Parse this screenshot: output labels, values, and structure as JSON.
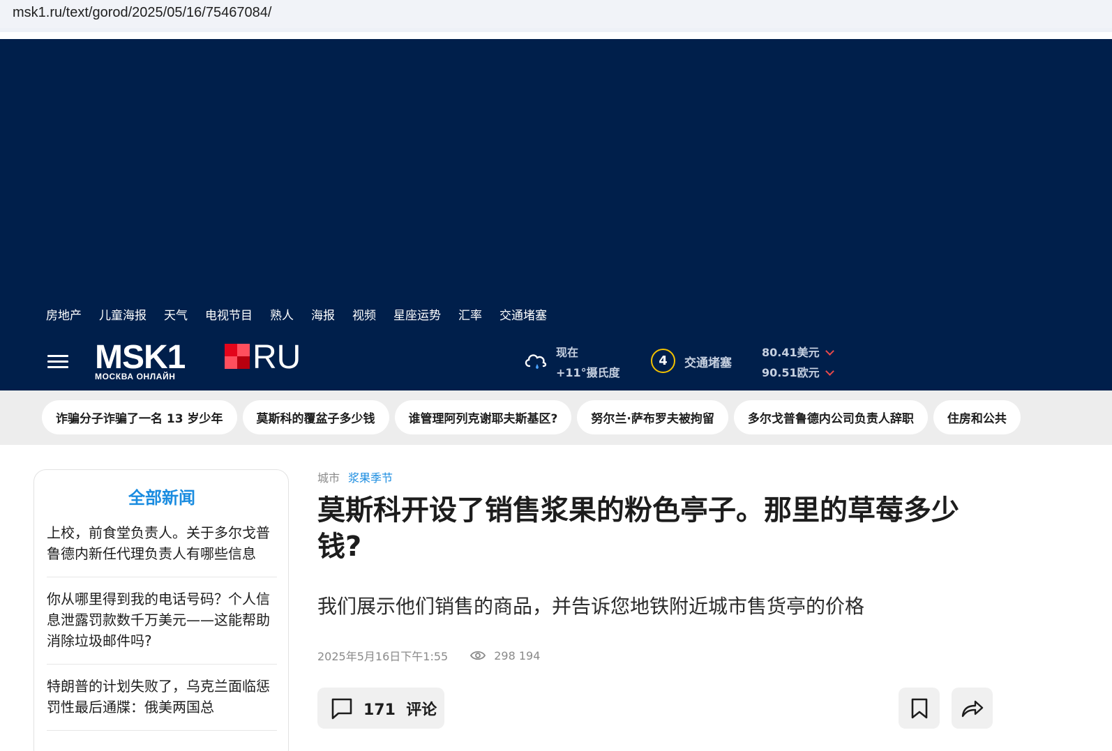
{
  "browser": {
    "url": "msk1.ru/text/gorod/2025/05/16/75467084/"
  },
  "header": {
    "nav": [
      "房地产",
      "儿童海报",
      "天气",
      "电视节目",
      "熟人",
      "海报",
      "视频",
      "星座运势",
      "汇率",
      "交通堵塞"
    ],
    "logo": {
      "main": "MSK1",
      "tld": "RU",
      "subtitle": "МОСКВА ОНЛАЙН"
    },
    "weather": {
      "now_label": "现在",
      "temperature": "+11°摄氏度"
    },
    "traffic": {
      "level": "4",
      "label": "交通堵塞"
    },
    "rates": {
      "usd": "80.41美元",
      "eur": "90.51欧元"
    }
  },
  "trending": [
    "诈骗分子诈骗了一名 13 岁少年",
    "莫斯科的覆盆子多少钱",
    "谁管理阿列克谢耶夫斯基区?",
    "努尔兰·萨布罗夫被拘留",
    "多尔戈普鲁德内公司负责人辞职",
    "住房和公共"
  ],
  "sidebar": {
    "title": "全部新闻",
    "items": [
      "上校，前食堂负责人。关于多尔戈普鲁德内新任代理负责人有哪些信息",
      "你从哪里得到我的电话号码？个人信息泄露罚款数千万美元——这能帮助消除垃圾邮件吗?",
      "特朗普的计划失败了，乌克兰面临惩罚性最后通牒：俄美两国总"
    ]
  },
  "article": {
    "breadcrumb": [
      "城市",
      "浆果季节"
    ],
    "headline": "莫斯科开设了销售浆果的粉色亭子。那里的草莓多少钱?",
    "lead": "我们展示他们销售的商品，并告诉您地铁附近城市售货亭的价格",
    "date": "2025年5月16日下午1:55",
    "views": "298 194",
    "comments_count": "171",
    "comments_label": "评论"
  },
  "colors": {
    "header_bg": "#001f4b",
    "accent_blue": "#1a8ce0",
    "logo_red": "#e3051b",
    "traffic_yellow": "#f3c200"
  }
}
